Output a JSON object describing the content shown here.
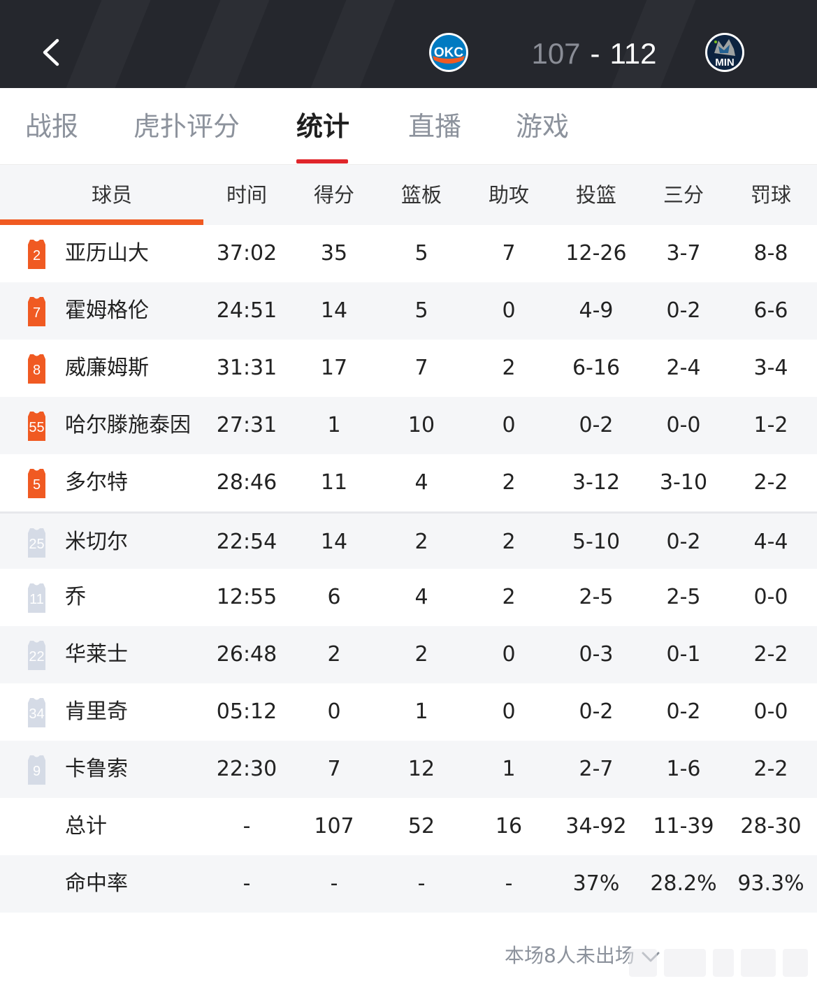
{
  "header": {
    "home_team": {
      "abbr": "OKC",
      "score": "107",
      "color": "#f05a22"
    },
    "away_team": {
      "abbr": "MIN",
      "score": "112",
      "color": "#0c2340"
    },
    "separator": "-",
    "back_icon": "chevron-left-icon"
  },
  "tabs": [
    {
      "label": "战报",
      "active": false
    },
    {
      "label": "虎扑评分",
      "active": false
    },
    {
      "label": "统计",
      "active": true
    },
    {
      "label": "直播",
      "active": false
    },
    {
      "label": "游戏",
      "active": false
    }
  ],
  "table": {
    "columns": [
      "球员",
      "时间",
      "得分",
      "篮板",
      "助攻",
      "投篮",
      "三分",
      "罚球"
    ],
    "starters": [
      {
        "number": "2",
        "name": "亚历山大",
        "time": "37:02",
        "pts": "35",
        "reb": "5",
        "ast": "7",
        "fg": "12-26",
        "three": "3-7",
        "ft": "8-8"
      },
      {
        "number": "7",
        "name": "霍姆格伦",
        "time": "24:51",
        "pts": "14",
        "reb": "5",
        "ast": "0",
        "fg": "4-9",
        "three": "0-2",
        "ft": "6-6"
      },
      {
        "number": "8",
        "name": "威廉姆斯",
        "time": "31:31",
        "pts": "17",
        "reb": "7",
        "ast": "2",
        "fg": "6-16",
        "three": "2-4",
        "ft": "3-4"
      },
      {
        "number": "55",
        "name": "哈尔滕施泰因",
        "time": "27:31",
        "pts": "1",
        "reb": "10",
        "ast": "0",
        "fg": "0-2",
        "three": "0-0",
        "ft": "1-2"
      },
      {
        "number": "5",
        "name": "多尔特",
        "time": "28:46",
        "pts": "11",
        "reb": "4",
        "ast": "2",
        "fg": "3-12",
        "three": "3-10",
        "ft": "2-2"
      }
    ],
    "bench": [
      {
        "number": "25",
        "name": "米切尔",
        "time": "22:54",
        "pts": "14",
        "reb": "2",
        "ast": "2",
        "fg": "5-10",
        "three": "0-2",
        "ft": "4-4"
      },
      {
        "number": "11",
        "name": "乔",
        "time": "12:55",
        "pts": "6",
        "reb": "4",
        "ast": "2",
        "fg": "2-5",
        "three": "2-5",
        "ft": "0-0"
      },
      {
        "number": "22",
        "name": "华莱士",
        "time": "26:48",
        "pts": "2",
        "reb": "2",
        "ast": "0",
        "fg": "0-3",
        "three": "0-1",
        "ft": "2-2"
      },
      {
        "number": "34",
        "name": "肯里奇",
        "time": "05:12",
        "pts": "0",
        "reb": "1",
        "ast": "0",
        "fg": "0-2",
        "three": "0-2",
        "ft": "0-0"
      },
      {
        "number": "9",
        "name": "卡鲁索",
        "time": "22:30",
        "pts": "7",
        "reb": "12",
        "ast": "1",
        "fg": "2-7",
        "three": "1-6",
        "ft": "2-2"
      }
    ],
    "totals": {
      "label": "总计",
      "time": "-",
      "pts": "107",
      "reb": "52",
      "ast": "16",
      "fg": "34-92",
      "three": "11-39",
      "ft": "28-30"
    },
    "percentages": {
      "label": "命中率",
      "time": "-",
      "pts": "-",
      "reb": "-",
      "ast": "-",
      "fg": "37%",
      "three": "28.2%",
      "ft": "93.3%"
    }
  },
  "footer": {
    "dnp_label": "本场8人未出场",
    "chevron_icon": "chevron-down-icon"
  },
  "colors": {
    "header_bg": "#25272d",
    "accent_red": "#e0262b",
    "accent_orange": "#f05a22",
    "starter_jersey": "#f05a22",
    "bench_jersey": "#d5dbe6"
  }
}
